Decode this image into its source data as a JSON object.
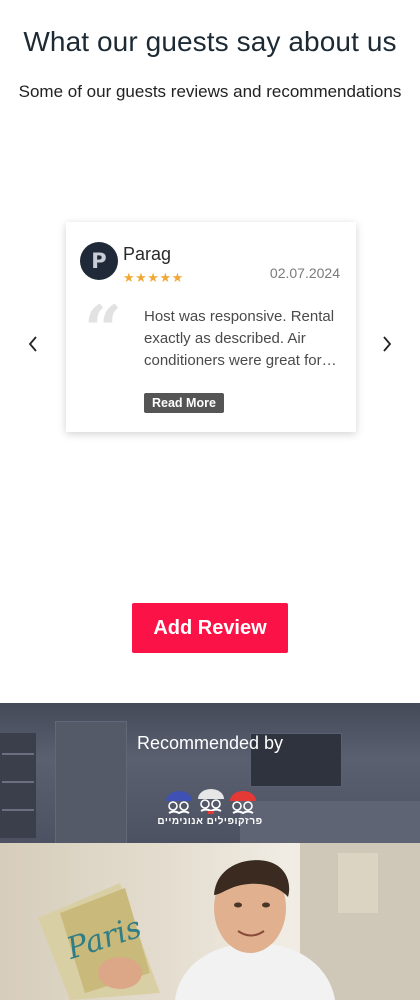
{
  "section": {
    "title": "What our guests say about us",
    "subtitle": "Some of our guests reviews and recommendations"
  },
  "carousel": {
    "prev_icon": "chevron-left-icon",
    "next_icon": "chevron-right-icon"
  },
  "review": {
    "avatar_initial": "P",
    "name": "Parag",
    "stars_text": "★★★★★",
    "rating": 5,
    "date": "02.07.2024",
    "quote_mark": "“",
    "text": "Host was responsive. Rental exactly as described. Air conditioners were great for…",
    "read_more": "Read More"
  },
  "actions": {
    "add_review": "Add Review"
  },
  "recommended": {
    "label": "Recommended by",
    "logo_text": "פרזקופילים אנונימיים"
  },
  "colors": {
    "accent": "#fb1347",
    "star": "#f0a936",
    "avatar_bg": "#1f2937"
  }
}
